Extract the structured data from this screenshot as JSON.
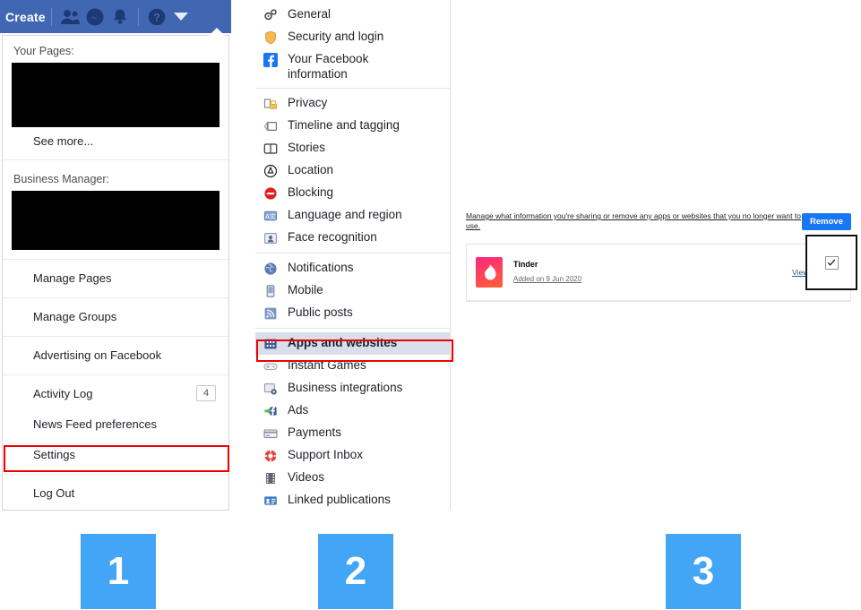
{
  "topbar": {
    "create_label": "Create",
    "icons": [
      {
        "name": "friend-requests-icon",
        "glyph": "people"
      },
      {
        "name": "messenger-icon",
        "glyph": "messenger"
      },
      {
        "name": "notifications-icon",
        "glyph": "bell"
      },
      {
        "name": "help-icon",
        "glyph": "question"
      },
      {
        "name": "account-caret-icon",
        "glyph": "caret-down"
      }
    ],
    "background_color": "#4267b2"
  },
  "account_menu": {
    "your_pages_label": "Your Pages:",
    "see_more_label": "See more...",
    "business_manager_label": "Business Manager:",
    "items": [
      {
        "label": "Manage Pages",
        "badge": ""
      },
      {
        "label": "Manage Groups",
        "badge": ""
      },
      {
        "label": "Advertising on Facebook",
        "badge": ""
      },
      {
        "label": "Activity Log",
        "badge": "4"
      },
      {
        "label": "News Feed preferences",
        "badge": ""
      },
      {
        "label": "Settings",
        "badge": ""
      },
      {
        "label": "Log Out",
        "badge": ""
      }
    ],
    "highlighted_item": "Settings",
    "highlight_color": "#ee0000"
  },
  "settings_nav": {
    "groups": [
      {
        "items": [
          {
            "label": "General",
            "icon": "gears-icon"
          },
          {
            "label": "Security and login",
            "icon": "shield-icon"
          },
          {
            "label": "Your Facebook information",
            "icon": "facebook-icon"
          }
        ]
      },
      {
        "items": [
          {
            "label": "Privacy",
            "icon": "lock-icon"
          },
          {
            "label": "Timeline and tagging",
            "icon": "timeline-icon"
          },
          {
            "label": "Stories",
            "icon": "book-icon"
          },
          {
            "label": "Location",
            "icon": "location-icon"
          },
          {
            "label": "Blocking",
            "icon": "block-icon"
          },
          {
            "label": "Language and region",
            "icon": "language-icon"
          },
          {
            "label": "Face recognition",
            "icon": "face-icon"
          }
        ]
      },
      {
        "items": [
          {
            "label": "Notifications",
            "icon": "globe-icon"
          },
          {
            "label": "Mobile",
            "icon": "phone-icon"
          },
          {
            "label": "Public posts",
            "icon": "rss-icon"
          }
        ]
      },
      {
        "items": [
          {
            "label": "Apps and websites",
            "icon": "apps-icon"
          },
          {
            "label": "Instant Games",
            "icon": "gamepad-icon"
          },
          {
            "label": "Business integrations",
            "icon": "business-icon"
          },
          {
            "label": "Ads",
            "icon": "ads-icon"
          },
          {
            "label": "Payments",
            "icon": "card-icon"
          },
          {
            "label": "Support Inbox",
            "icon": "lifebuoy-icon"
          },
          {
            "label": "Videos",
            "icon": "film-icon"
          },
          {
            "label": "Linked publications",
            "icon": "publications-icon"
          }
        ]
      }
    ],
    "active_item": "Apps and websites",
    "active_background": "#d8dfea",
    "highlight_color": "#ee0000"
  },
  "apps_page": {
    "manage_note": "Manage what information you're sharing or remove any apps or websites that you no longer want to use.",
    "remove_label": "Remove",
    "remove_color": "#1877f2",
    "apps": [
      {
        "name": "Tinder",
        "added": "Added on 9 Jun 2020",
        "link_label": "View and edit",
        "selected": true,
        "icon": "tinder-flame-icon"
      }
    ]
  },
  "steps": [
    {
      "number": "1"
    },
    {
      "number": "2"
    },
    {
      "number": "3"
    }
  ],
  "step_badge_color": "#42a5f5"
}
